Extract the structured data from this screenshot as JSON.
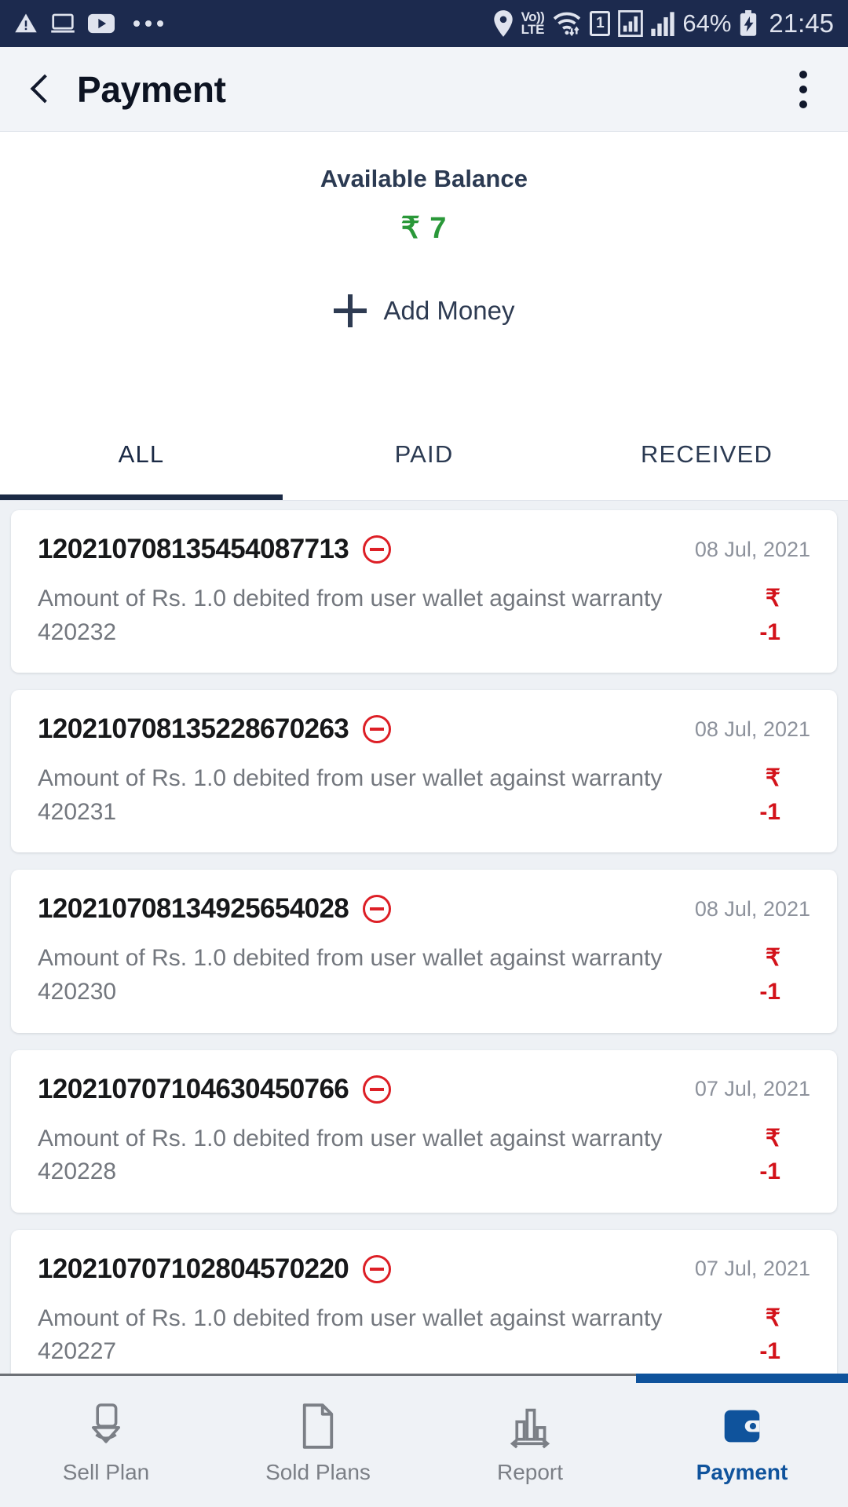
{
  "status_bar": {
    "left_icons": [
      "warning-triangle-icon",
      "desktop-icon",
      "youtube-icon",
      "more-dots-icon"
    ],
    "location_icon": "location-pin-icon",
    "volte_top": "Vo))",
    "volte_bottom": "LTE",
    "wifi_icon": "wifi-icon",
    "sim_label": "1",
    "signal_icon_1": "signal-boxed-icon",
    "signal_icon_2": "signal-bars-icon",
    "battery_percent": "64%",
    "battery_icon": "battery-charging-icon",
    "time": "21:45"
  },
  "appbar": {
    "back_icon": "back-chevron-icon",
    "title": "Payment",
    "overflow_icon": "overflow-menu-icon"
  },
  "balance": {
    "label": "Available Balance",
    "amount": "₹ 7",
    "add_money_label": "Add Money",
    "add_icon": "plus-icon",
    "amount_color": "#2a9839"
  },
  "tabs": [
    {
      "label": "ALL",
      "active": true
    },
    {
      "label": "PAID",
      "active": false
    },
    {
      "label": "RECEIVED",
      "active": false
    }
  ],
  "transactions": [
    {
      "id": "120210708135454087713",
      "type_icon": "minus-circle-icon",
      "date": "08 Jul, 2021",
      "description": "Amount of Rs. 1.0 debited from user wallet against warranty 420232",
      "currency": "₹",
      "amount": "-1"
    },
    {
      "id": "120210708135228670263",
      "type_icon": "minus-circle-icon",
      "date": "08 Jul, 2021",
      "description": "Amount of Rs. 1.0 debited from user wallet against warranty 420231",
      "currency": "₹",
      "amount": "-1"
    },
    {
      "id": "120210708134925654028",
      "type_icon": "minus-circle-icon",
      "date": "08 Jul, 2021",
      "description": "Amount of Rs. 1.0 debited from user wallet against warranty 420230",
      "currency": "₹",
      "amount": "-1"
    },
    {
      "id": "120210707104630450766",
      "type_icon": "minus-circle-icon",
      "date": "07 Jul, 2021",
      "description": "Amount of Rs. 1.0 debited from user wallet against warranty 420228",
      "currency": "₹",
      "amount": "-1"
    },
    {
      "id": "120210707102804570220",
      "type_icon": "minus-circle-icon",
      "date": "07 Jul, 2021",
      "description": "Amount of Rs. 1.0 debited from user wallet against warranty 420227",
      "currency": "₹",
      "amount": "-1"
    }
  ],
  "bottom_nav": [
    {
      "label": "Sell Plan",
      "icon": "sell-plan-icon",
      "active": false
    },
    {
      "label": "Sold Plans",
      "icon": "document-icon",
      "active": false
    },
    {
      "label": "Report",
      "icon": "bar-chart-icon",
      "active": false
    },
    {
      "label": "Payment",
      "icon": "wallet-icon",
      "active": true
    }
  ],
  "colors": {
    "status_bar_bg": "#1c2a4e",
    "accent_blue": "#0f539c",
    "debit_red": "#d3121a",
    "balance_green": "#2a9839"
  }
}
